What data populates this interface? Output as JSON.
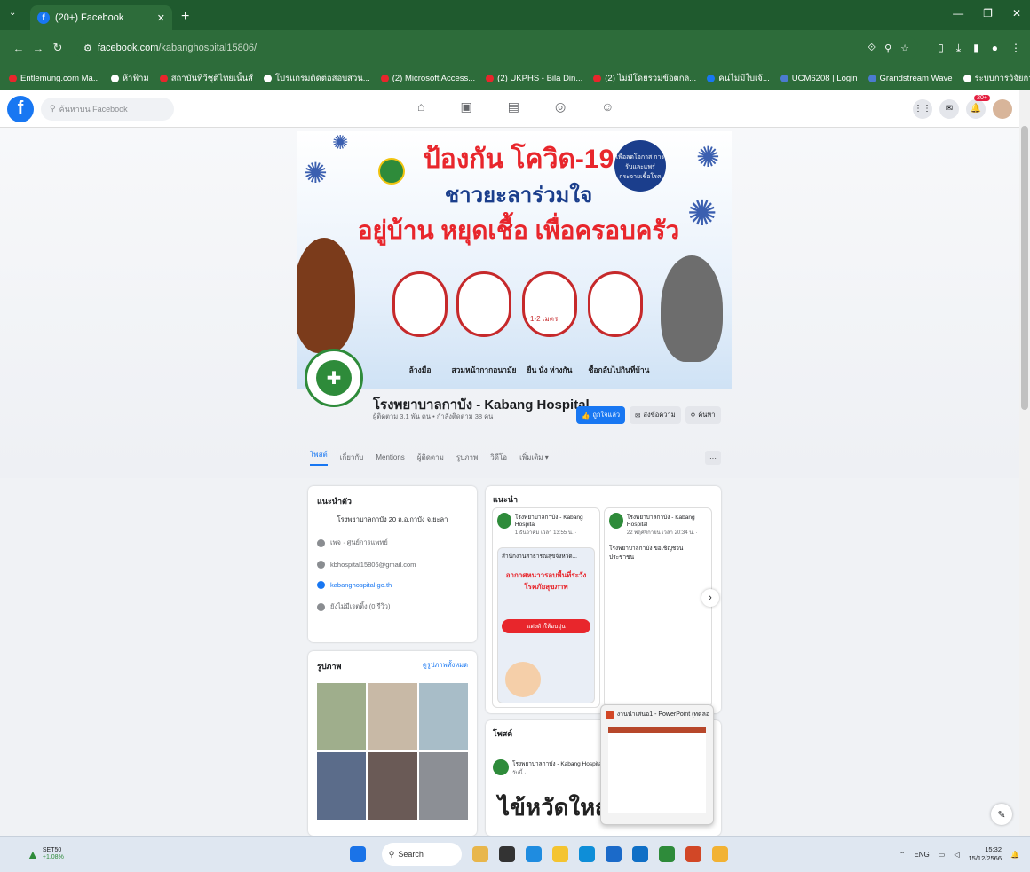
{
  "browser": {
    "tab_title": "(20+) Facebook",
    "url_host": "facebook.com",
    "url_path": "/kabanghospital15806/",
    "bookmarks": [
      {
        "label": "Entlemung.com Ma...",
        "color": "#e8262c"
      },
      {
        "label": "ห้าฟ้าม",
        "color": "#ffffff"
      },
      {
        "label": "สถาบันทีวีชุติไทยเนิ้นส์",
        "color": "#e8262c"
      },
      {
        "label": "โปรแกรมติดต่อสอบสวน...",
        "color": "#ffffff"
      },
      {
        "label": "(2) Microsoft Access...",
        "color": "#e8262c"
      },
      {
        "label": "(2) UKPHS - Bila Din...",
        "color": "#e8262c"
      },
      {
        "label": "(2) ไม่มีโดยรวมข้อตกล...",
        "color": "#e8262c"
      },
      {
        "label": "คนไม่มีใบเจ้...",
        "color": "#1877f2"
      },
      {
        "label": "UCM6208 | Login",
        "color": "#4b7bd0"
      },
      {
        "label": "Grandstream Wave",
        "color": "#4b7bd0"
      },
      {
        "label": "ระบบการวิจัยการสอบสวน...",
        "color": "#ffffff"
      }
    ]
  },
  "facebook": {
    "search_placeholder": "ค้นหาบน Facebook",
    "notif_badge": "20+"
  },
  "cover": {
    "line1": "ป้องกัน โควิด-19",
    "line2": "ชาวยะลาร่วมใจ",
    "line3": "อยู่บ้าน หยุดเชื้อ เพื่อครอบครัว",
    "badge": "เพื่อลดโอกาส การรับและแพร่ กระจายเชื้อโรค",
    "distance": "1-2 เมตร",
    "items": [
      "ล้างมือ",
      "สวมหน้ากากอนามัย",
      "ยืน นั่ง ห่างกัน",
      "ซื้อกลับไปกินที่บ้าน"
    ]
  },
  "page": {
    "name": "โรงพยาบาลกาบัง - Kabang Hospital",
    "stats": "ผู้ติดตาม 3.1 พัน คน • กำลังติดตาม 38 คน",
    "btn_follow": "ถูกใจแล้ว",
    "btn_message": "ส่งข้อความ",
    "btn_search": "ค้นหา",
    "tabs": [
      "โพสต์",
      "เกี่ยวกับ",
      "Mentions",
      "ผู้ติดตาม",
      "รูปภาพ",
      "วิดีโอ",
      "เพิ่มเติม ▾"
    ],
    "more": "···"
  },
  "intro": {
    "title": "แนะนำตัว",
    "text": "โรงพยาบาลกาบัง 20 ถ.อ.กาบัง จ.ยะลา",
    "rows": [
      "เพจ · ศูนย์การแพทย์",
      "kbhospital15806@gmail.com",
      "kabanghospital.go.th",
      "ยังไม่มีเรตติ้ง (0 รีวิว)"
    ]
  },
  "photos": {
    "title": "รูปภาพ",
    "link": "ดูรูปภาพทั้งหมด"
  },
  "featured": {
    "title": "แนะนำ",
    "posts": [
      {
        "author": "โรงพยาบาลกาบัง - Kabang Hospital",
        "time": "1 ธันวาคม เวลา 13:55 น. ·",
        "body": "สำนักงานสาธารณสุขจังหวัด..."
      },
      {
        "author": "โรงพยาบาลกาบัง - Kabang Hospital",
        "time": "22 พฤศจิกายน เวลา 20:34 น. ·",
        "body": "โรงพยาบาลกาบัง ขอเชิญชวนประชาชน"
      }
    ],
    "banner": "อากาศหนาวรอบพื้นที่ระวังโรคภัยสุขภาพ",
    "banner_sub": "แต่งตัวให้อบอุ่น"
  },
  "posts": {
    "title": "โพสต์",
    "author": "โรงพยาบาลกาบัง - Kabang Hospital",
    "time": "วันนี้ ·",
    "headline": "ไข้หวัดใหญ่"
  },
  "popup": {
    "title": "งานนำเสนอ1 - PowerPoint (ทดลองใช้)"
  },
  "taskbar": {
    "stock": "SET50",
    "stock_change": "+1.08%",
    "search": "Search",
    "lang": "ENG",
    "time": "15:32",
    "date": "15/12/2566"
  }
}
